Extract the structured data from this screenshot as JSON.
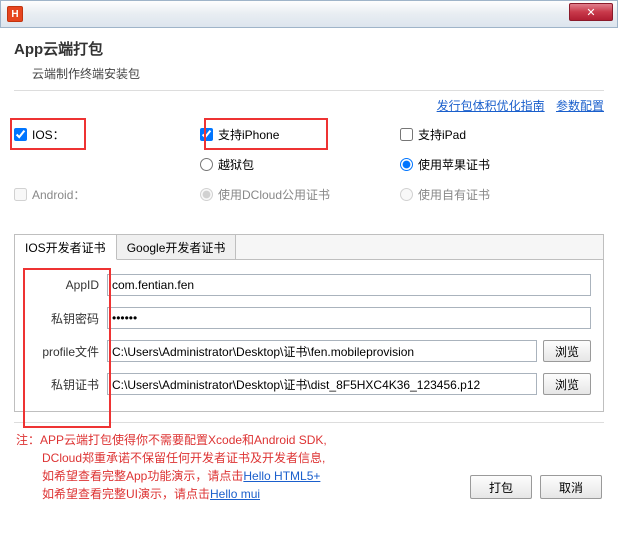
{
  "header": {
    "title": "App云端打包",
    "subtitle": "云端制作终端安装包"
  },
  "links": {
    "guide": "发行包体积优化指南",
    "params": "参数配置"
  },
  "ios": {
    "label": "IOS：",
    "iphone": "支持iPhone",
    "ipad": "支持iPad",
    "jailbreak": "越狱包",
    "cert": "使用苹果证书"
  },
  "android": {
    "label": "Android：",
    "dcloud": "使用DCloud公用证书",
    "own": "使用自有证书"
  },
  "tabs": {
    "ios": "IOS开发者证书",
    "google": "Google开发者证书"
  },
  "form": {
    "appid_label": "AppID",
    "appid_value": "com.fentian.fen",
    "pwd_label": "私钥密码",
    "pwd_value": "••••••",
    "profile_label": "profile文件",
    "profile_value": "C:\\Users\\Administrator\\Desktop\\证书\\fen.mobileprovision",
    "cert_label": "私钥证书",
    "cert_value": "C:\\Users\\Administrator\\Desktop\\证书\\dist_8F5HXC4K36_123456.p12",
    "browse": "浏览"
  },
  "note": {
    "prefix": "注：",
    "l1": "APP云端打包使得你不需要配置Xcode和Android SDK,",
    "l2": "DCloud郑重承诺不保留任何开发者证书及开发者信息,",
    "l3a": "如希望查看完整App功能演示，请点击",
    "l3b": "Hello HTML5+",
    "l4a": "如希望查看完整UI演示，请点击",
    "l4b": "Hello mui"
  },
  "buttons": {
    "pack": "打包",
    "cancel": "取消"
  }
}
